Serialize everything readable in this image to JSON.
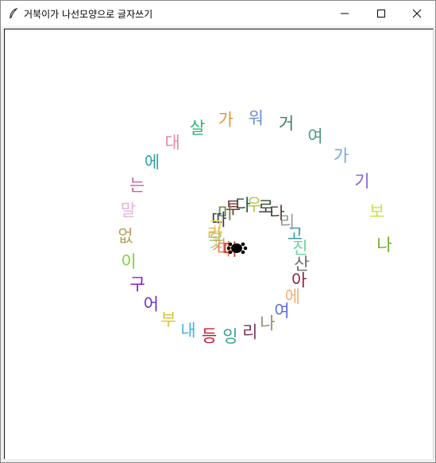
{
  "window": {
    "title": "거북이가 나선모양으로 글자쓰기",
    "icons": {
      "app": "feather-icon",
      "minimize": "minimize-icon",
      "maximize": "maximize-icon",
      "close": "close-icon"
    }
  },
  "canvas": {
    "background": "#ffffff",
    "turtle_color": "#000000",
    "glyphs": [
      {
        "ch": "나",
        "color": "#6fae24"
      },
      {
        "ch": "보",
        "color": "#c9e34a"
      },
      {
        "ch": "기",
        "color": "#8a63d2"
      },
      {
        "ch": "가",
        "color": "#7aa6d6"
      },
      {
        "ch": "여",
        "color": "#4c9a7a"
      },
      {
        "ch": "거",
        "color": "#3d7f66"
      },
      {
        "ch": "워",
        "color": "#6a8fc9"
      },
      {
        "ch": "가",
        "color": "#e3963e"
      },
      {
        "ch": "살",
        "color": "#2bb673"
      },
      {
        "ch": "대",
        "color": "#e889a6"
      },
      {
        "ch": "에",
        "color": "#2fa3a3"
      },
      {
        "ch": "는",
        "color": "#cc5fa0"
      },
      {
        "ch": "말",
        "color": "#e7b3e0"
      },
      {
        "ch": "없",
        "color": "#b8a25a"
      },
      {
        "ch": "이",
        "color": "#7fd13b"
      },
      {
        "ch": "구",
        "color": "#8b1fc9"
      },
      {
        "ch": "어",
        "color": "#6a2fc9"
      },
      {
        "ch": "부",
        "color": "#d3c63a"
      },
      {
        "ch": "내",
        "color": "#45b1e6"
      },
      {
        "ch": "등",
        "color": "#c41f3a"
      },
      {
        "ch": "잉",
        "color": "#3aa38a"
      },
      {
        "ch": "리",
        "color": "#7a3a5a"
      },
      {
        "ch": "나",
        "color": "#9b8a6a"
      },
      {
        "ch": "여",
        "color": "#5a6ae3"
      },
      {
        "ch": "에",
        "color": "#f0b37a"
      },
      {
        "ch": "아",
        "color": "#8a1f3a"
      },
      {
        "ch": "산",
        "color": "#6a6a6a"
      },
      {
        "ch": "진",
        "color": "#6ad3a3"
      },
      {
        "ch": "고",
        "color": "#3a9aa3"
      },
      {
        "ch": "리",
        "color": "#9a9a9a"
      },
      {
        "ch": "다",
        "color": "#5a3a3a"
      },
      {
        "ch": "로",
        "color": "#3a4a3a"
      },
      {
        "ch": "우",
        "color": "#b8c94a"
      },
      {
        "ch": "다",
        "color": "#1f5a4a"
      },
      {
        "ch": "투",
        "color": "#7a2f3a"
      },
      {
        "ch": "미",
        "color": "#5a8a3a"
      },
      {
        "ch": "따",
        "color": "#3a3a5a"
      },
      {
        "ch": "고",
        "color": "#f0e04a"
      },
      {
        "ch": "라",
        "color": "#e3b35a"
      },
      {
        "ch": "웃",
        "color": "#a3d37a"
      },
      {
        "ch": "가",
        "color": "#e3a37a"
      },
      {
        "ch": "다",
        "color": "#f07a4a"
      },
      {
        "ch": "다",
        "color": "#c9302a"
      }
    ]
  }
}
